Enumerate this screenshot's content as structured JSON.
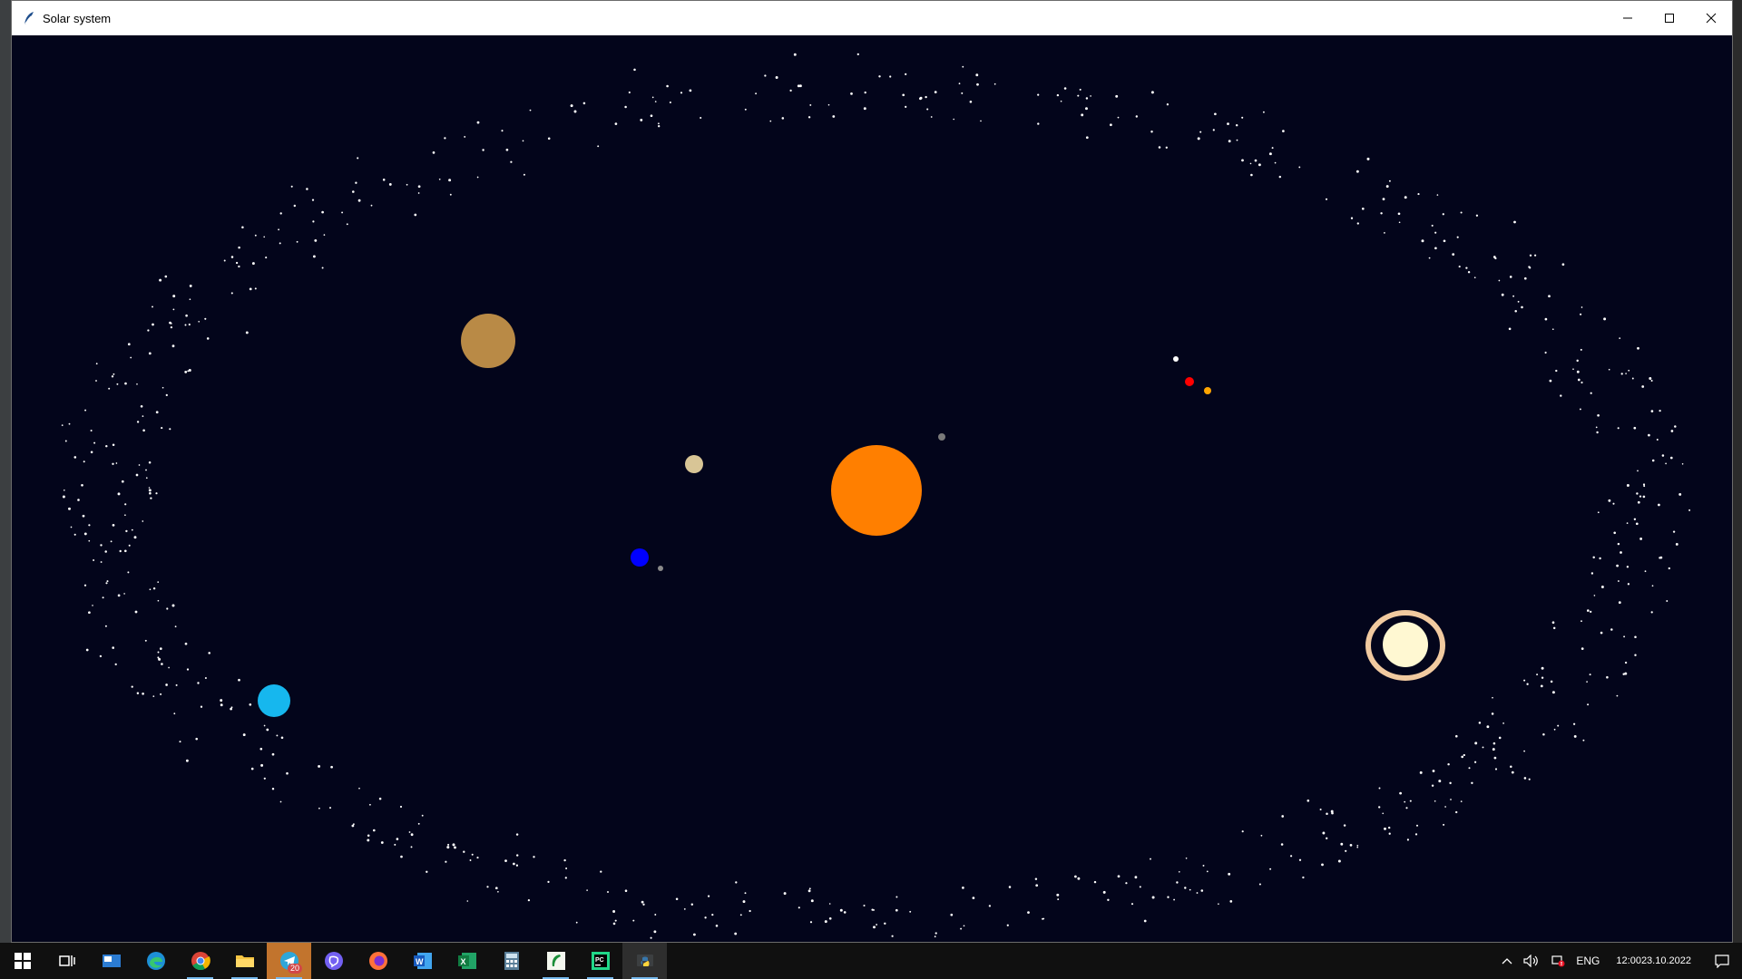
{
  "window": {
    "title": "Solar system",
    "minimize_icon": "minimize-icon",
    "maximize_icon": "maximize-icon",
    "close_icon": "close-icon"
  },
  "canvas": {
    "background": "#03051b",
    "star_color": "#ffffff"
  },
  "bodies": [
    {
      "name": "sun",
      "color": "#ff7f00"
    },
    {
      "name": "jupiter",
      "color": "#b98a46"
    },
    {
      "name": "venus",
      "color": "#d8c596"
    },
    {
      "name": "earth",
      "color": "#0000ff"
    },
    {
      "name": "moon",
      "color": "#8a8a8a"
    },
    {
      "name": "mercury",
      "color": "#7a7a7a"
    },
    {
      "name": "uranus",
      "color": "#16b7ee"
    },
    {
      "name": "saturn",
      "color": "#fff8d2",
      "ring_color": "#f1caa0"
    },
    {
      "name": "mars",
      "color": "#ff0000"
    },
    {
      "name": "small-orange",
      "color": "#ffa500"
    },
    {
      "name": "small-white",
      "color": "#ffffff"
    }
  ],
  "taskbar": {
    "items": [
      {
        "name": "start-button",
        "icon": "windows-logo-icon"
      },
      {
        "name": "task-view-button",
        "icon": "task-view-icon"
      },
      {
        "name": "mail-button",
        "icon": "mail-icon"
      },
      {
        "name": "edge-button",
        "icon": "edge-icon"
      },
      {
        "name": "chrome-button",
        "icon": "chrome-icon"
      },
      {
        "name": "file-explorer-button",
        "icon": "folder-icon"
      },
      {
        "name": "telegram-button",
        "icon": "telegram-icon",
        "badge": "20"
      },
      {
        "name": "viber-button",
        "icon": "viber-icon"
      },
      {
        "name": "firefox-button",
        "icon": "firefox-icon"
      },
      {
        "name": "word-button",
        "icon": "word-icon"
      },
      {
        "name": "excel-button",
        "icon": "excel-icon"
      },
      {
        "name": "calculator-button",
        "icon": "calculator-icon"
      },
      {
        "name": "app-green-button",
        "icon": "app-icon"
      },
      {
        "name": "pycharm-button",
        "icon": "pycharm-icon"
      },
      {
        "name": "python-button",
        "icon": "python-icon"
      }
    ],
    "tray": {
      "language": "ENG",
      "time": "12:00",
      "date": "23.10.2022"
    }
  }
}
